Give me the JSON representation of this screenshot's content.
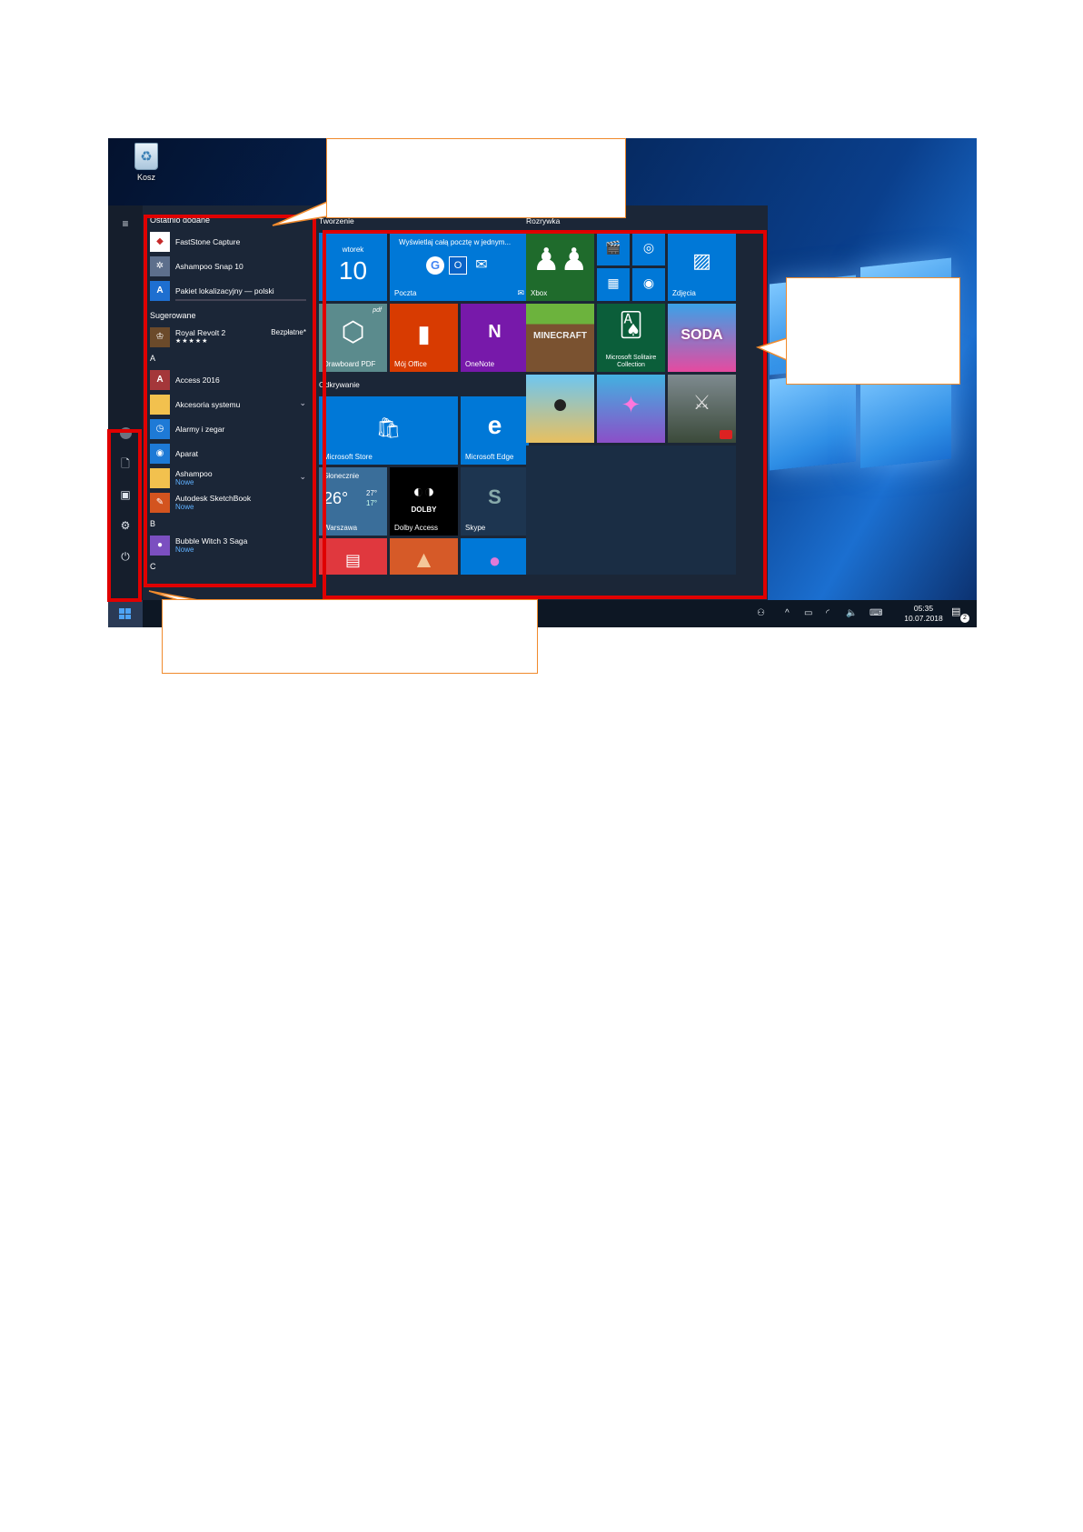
{
  "desktop": {
    "recycle_bin_label": "Kosz"
  },
  "apps_list": {
    "recent_header": "Ostatnio dodane",
    "recent": [
      {
        "name": "FastStone Capture",
        "icon": "faststone-icon",
        "color": "#1565c0"
      },
      {
        "name": "Ashampoo Snap 10",
        "icon": "ashampoo-snap-icon",
        "color": "#6a7fa0"
      },
      {
        "name": "Pakiet lokalizacyjny — polski",
        "icon": "language-pack-icon",
        "color": "#1e6fd0",
        "progress": 0.0
      }
    ],
    "suggested_header": "Sugerowane",
    "suggested": {
      "name": "Royal Revolt 2",
      "badge": "Bezpłatne*",
      "stars": "★★★★★"
    },
    "letter_a": "A",
    "a_items": [
      {
        "name": "Access 2016",
        "icon": "access-icon",
        "color": "#a4373a",
        "glyph": "A"
      },
      {
        "name": "Akcesoria systemu",
        "icon": "folder-icon",
        "color": "#f2c14e",
        "chevron": "⌄"
      },
      {
        "name": "Alarmy i zegar",
        "icon": "alarm-clock-icon",
        "color": "#1e7ad6",
        "glyph": "◷"
      },
      {
        "name": "Aparat",
        "icon": "camera-icon",
        "color": "#1e7ad6",
        "glyph": "◉"
      }
    ],
    "ashampoo": {
      "name": "Ashampoo",
      "sub": "Nowe",
      "chevron": "⌄"
    },
    "autodesk": {
      "name": "Autodesk SketchBook",
      "sub": "Nowe"
    },
    "letter_b": "B",
    "bubble": {
      "name": "Bubble Witch 3 Saga",
      "sub": "Nowe"
    },
    "letter_c": "C"
  },
  "tiles": {
    "group_create": "Tworzenie",
    "group_play": "Rozrywka",
    "group_explore": "Odkrywanie",
    "calendar": {
      "day": "wtorek",
      "date": "10"
    },
    "mail": {
      "title": "Wyświetlaj całą pocztę w jednym...",
      "label": "Poczta"
    },
    "drawboard": {
      "label": "Drawboard PDF",
      "tag": "pdf"
    },
    "office": {
      "label": "Mój Office"
    },
    "onenote": {
      "label": "OneNote"
    },
    "xbox": {
      "label": "Xbox"
    },
    "photos": {
      "label": "Zdjęcia"
    },
    "minecraft": {
      "label": "MINECRAFT"
    },
    "solitaire": {
      "label": "Microsoft Solitaire Collection"
    },
    "candy": {
      "label": "SODA"
    },
    "store": {
      "label": "Microsoft Store"
    },
    "edge": {
      "label": "Microsoft Edge"
    },
    "weather": {
      "condition": "Słonecznie",
      "temp": "26°",
      "high": "27°",
      "low": "17°",
      "city": "Warszawa"
    },
    "dolby": {
      "brand": "DOLBY",
      "label": "Dolby Access"
    },
    "skype": {
      "label": "Skype"
    }
  },
  "taskbar": {
    "time": "05:35",
    "date": "10.07.2018",
    "notifications": "2"
  },
  "colors": {
    "highlight": "#e00000",
    "callout_border": "#f08a2c",
    "accent": "#0078d7"
  }
}
